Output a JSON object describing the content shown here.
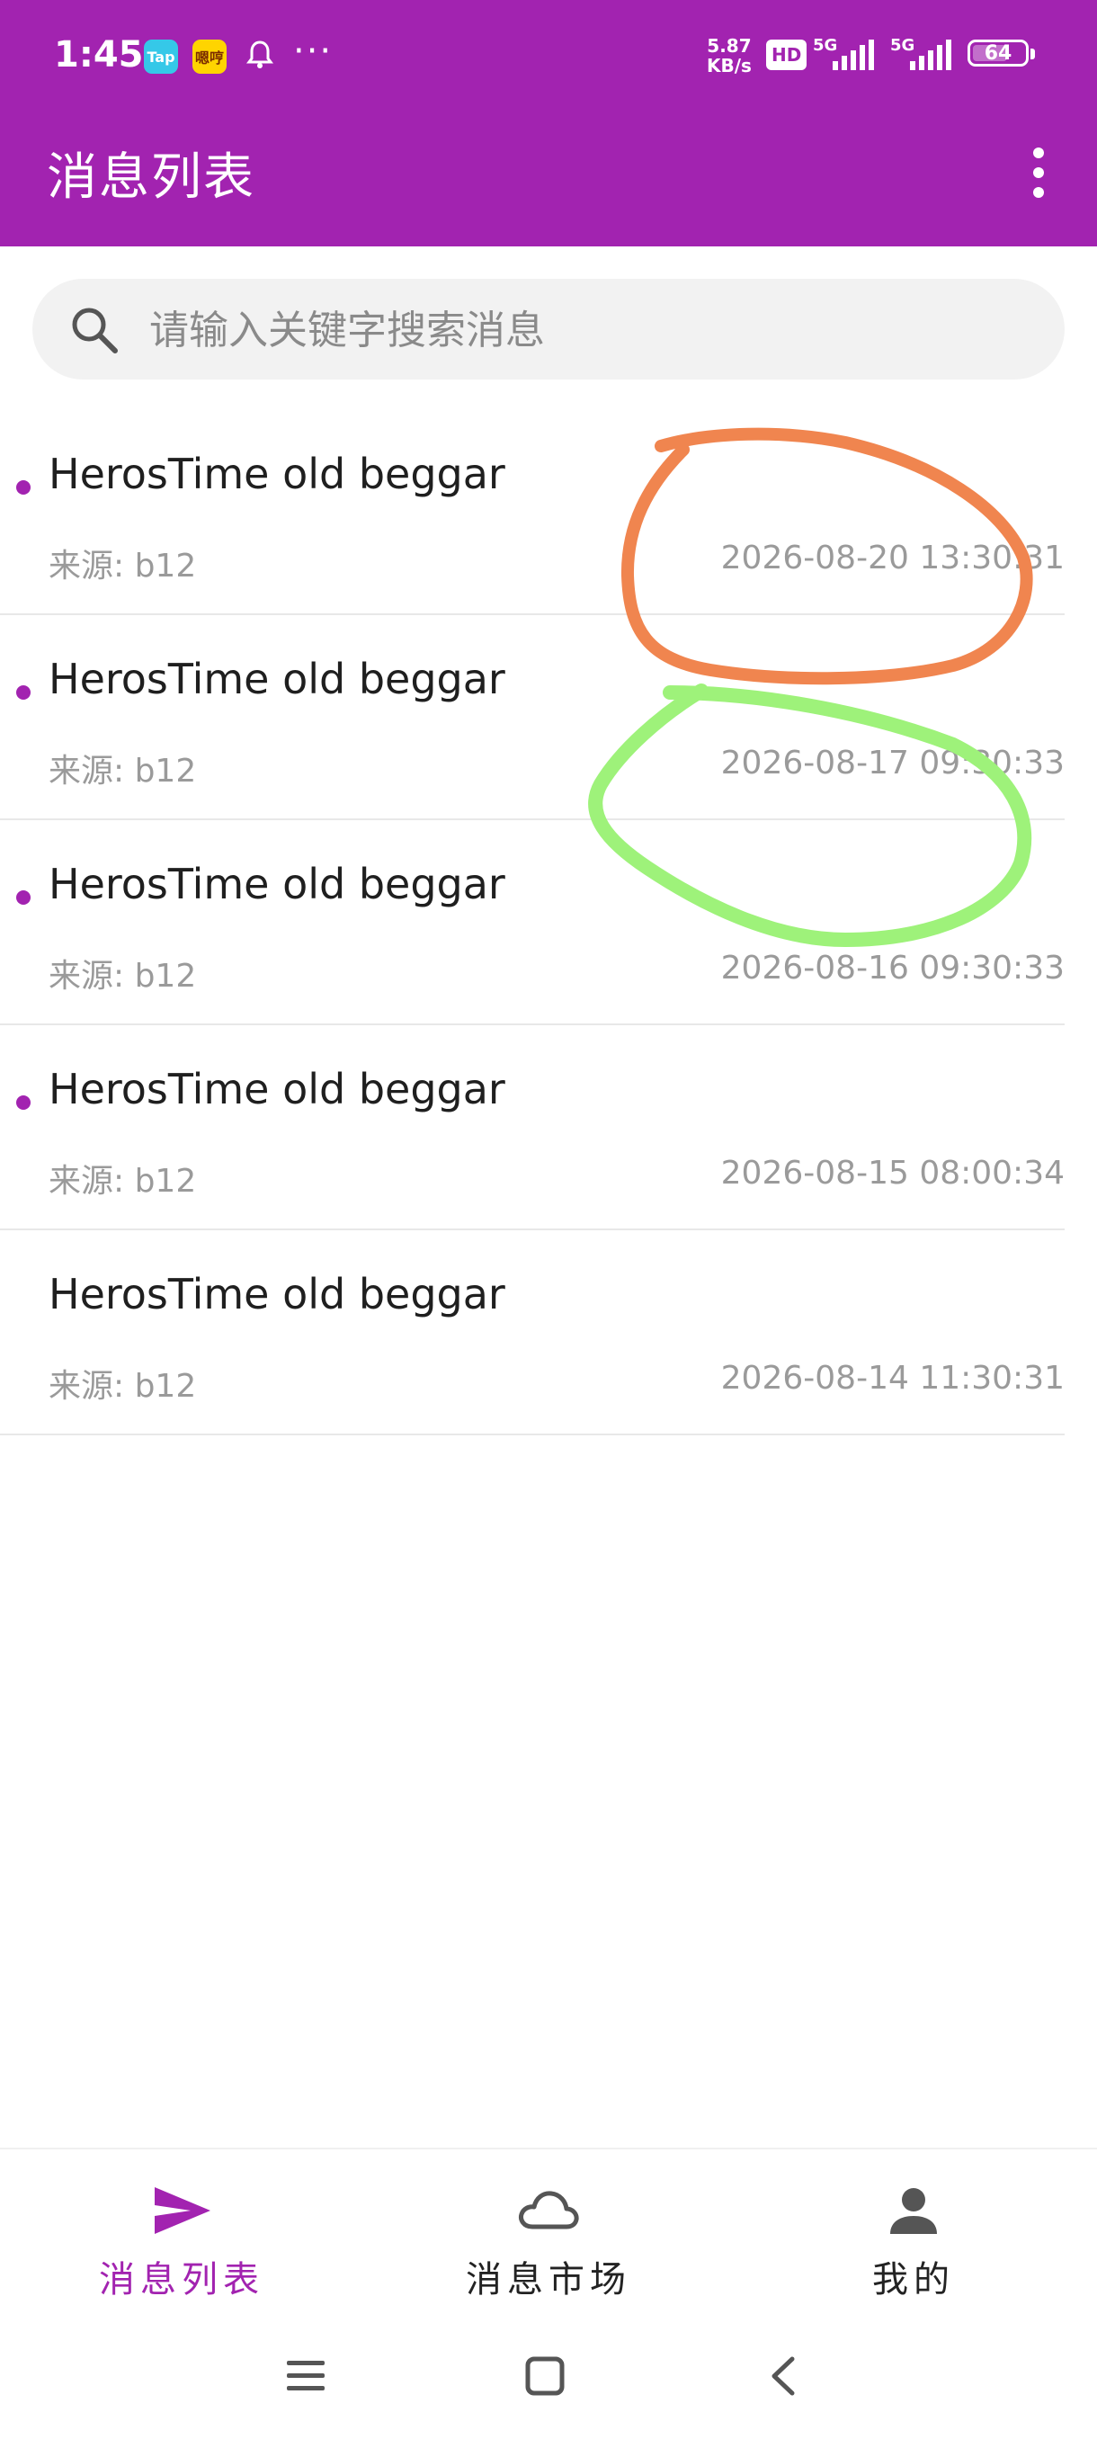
{
  "status_bar": {
    "time": "1:45",
    "app_icons": [
      "Tap",
      "嗯哼"
    ],
    "more": "···",
    "speed_value": "5.87",
    "speed_unit": "KB/s",
    "hd_label": "HD",
    "net1": "5G",
    "net2": "5G",
    "battery": "64"
  },
  "header": {
    "title": "消息列表"
  },
  "search": {
    "placeholder": "请输入关键字搜索消息"
  },
  "messages": [
    {
      "title": "HerosTime old beggar",
      "source": "来源: b12",
      "time": "2026-08-20 13:30:31",
      "unread": true
    },
    {
      "title": "HerosTime old beggar",
      "source": "来源: b12",
      "time": "2026-08-17 09:30:33",
      "unread": true
    },
    {
      "title": "HerosTime old beggar",
      "source": "来源: b12",
      "time": "2026-08-16 09:30:33",
      "unread": true
    },
    {
      "title": "HerosTime old beggar",
      "source": "来源: b12",
      "time": "2026-08-15 08:00:34",
      "unread": true
    },
    {
      "title": "HerosTime old beggar",
      "source": "来源: b12",
      "time": "2026-08-14 11:30:31",
      "unread": false
    }
  ],
  "bottom_nav": [
    {
      "label": "消息列表",
      "icon": "send-icon",
      "active": true
    },
    {
      "label": "消息市场",
      "icon": "cloud-icon",
      "active": false
    },
    {
      "label": "我的",
      "icon": "person-icon",
      "active": false
    }
  ],
  "annotations": {
    "orange": "#f0854f",
    "green": "#9ef27a"
  },
  "colors": {
    "primary": "#a223b0",
    "muted_text": "#9a9a9a"
  },
  "system_nav": [
    "menu-icon",
    "home-icon",
    "back-icon"
  ]
}
